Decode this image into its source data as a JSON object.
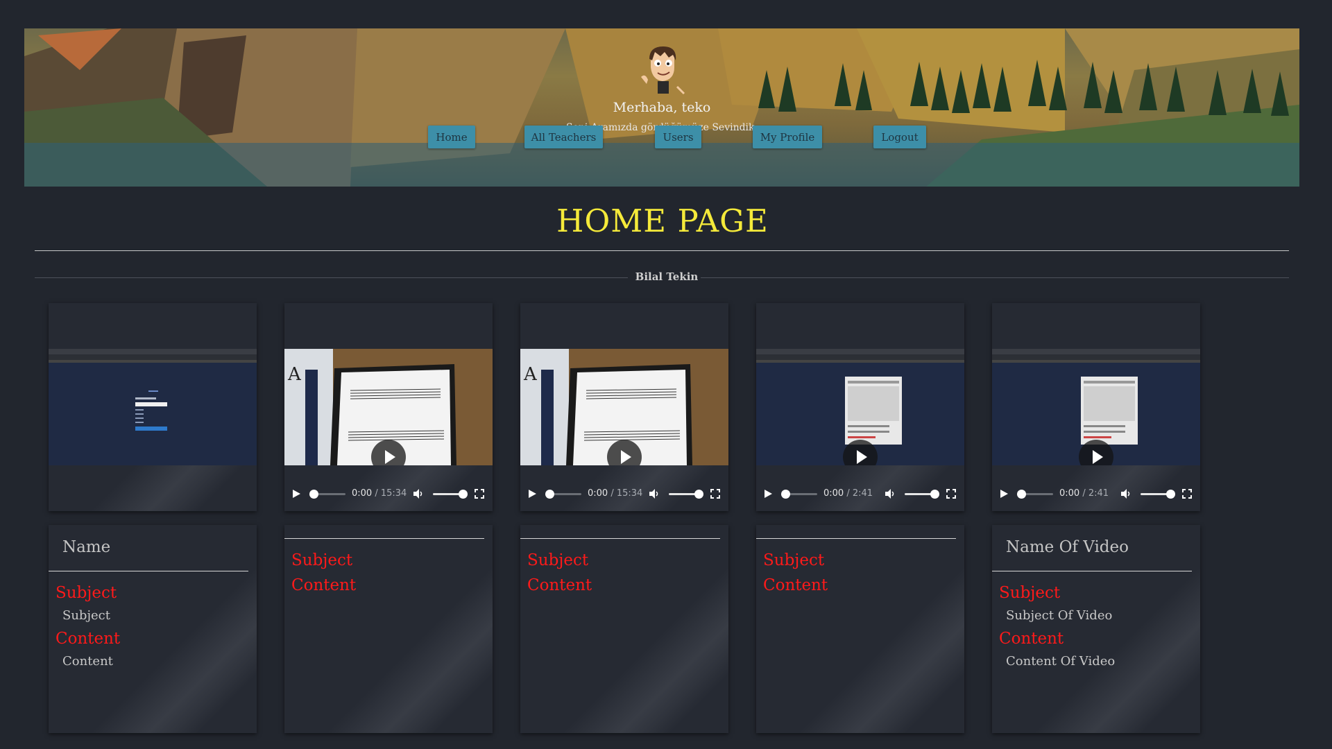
{
  "header": {
    "greeting": "Merhaba, teko",
    "subtitle": "Seni Aramızda gördüğümüze Sevindik."
  },
  "nav": {
    "items": [
      {
        "label": "Home"
      },
      {
        "label": "All Teachers"
      },
      {
        "label": "Users"
      },
      {
        "label": "My Profile"
      },
      {
        "label": "Logout"
      }
    ]
  },
  "main": {
    "page_title": "HOME PAGE",
    "section_title": "Bilal Tekin"
  },
  "videos": [
    {
      "thumbnail": "web-page-screenshot"
    },
    {
      "thumbnail": "sheet-music",
      "current": "0:00",
      "duration": "15:34"
    },
    {
      "thumbnail": "sheet-music",
      "current": "0:00",
      "duration": "15:34"
    },
    {
      "thumbnail": "web-page-screenshot",
      "current": "0:00",
      "duration": "2:41"
    },
    {
      "thumbnail": "web-page-screenshot",
      "current": "0:00",
      "duration": "2:41"
    }
  ],
  "time_separator": " / ",
  "info": [
    {
      "name": "Name",
      "subject_label": "Subject",
      "subject": "Subject",
      "content_label": "Content",
      "content": "Content"
    },
    {
      "name": "",
      "subject_label": "Subject",
      "subject": "",
      "content_label": "Content",
      "content": ""
    },
    {
      "name": "",
      "subject_label": "Subject",
      "subject": "",
      "content_label": "Content",
      "content": ""
    },
    {
      "name": "",
      "subject_label": "Subject",
      "subject": "",
      "content_label": "Content",
      "content": ""
    },
    {
      "name": "Name Of Video",
      "subject_label": "Subject",
      "subject": "Subject Of Video",
      "content_label": "Content",
      "content": "Content Of Video"
    }
  ],
  "colors": {
    "background": "#22262e",
    "title": "#f5ea3a",
    "label_red": "#ff1a1a",
    "nav_button": "#3d8fa8"
  }
}
